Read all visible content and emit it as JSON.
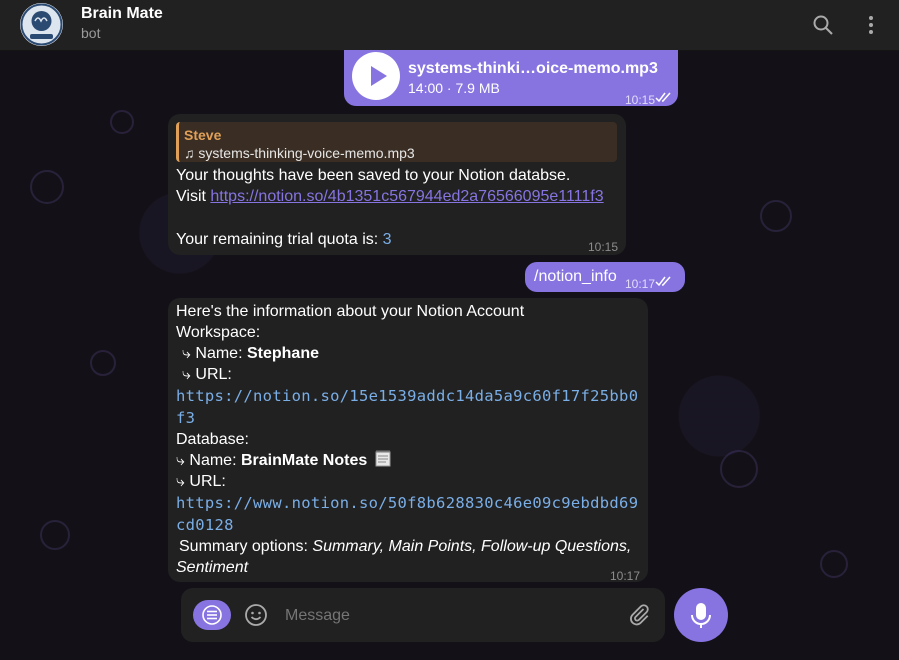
{
  "header": {
    "title": "Brain Mate",
    "subtitle": "bot",
    "avatar_label": "BrainMate"
  },
  "messages": {
    "audio": {
      "filename": "systems-thinki…oice-memo.mp3",
      "meta": "14:00 · 7.9 MB",
      "time": "10:15"
    },
    "saved": {
      "reply_author": "Steve",
      "reply_file": "systems-thinking-voice-memo.mp3",
      "reply_icon": "♫",
      "line1": "Your thoughts have been saved to your Notion databse.",
      "visit_label": "Visit",
      "link": "https://notion.so/4b1351c567944ed2a76566095e1111f3",
      "quota_label": "Your remaining trial quota is:",
      "quota_value": "3",
      "time": "10:15"
    },
    "command": {
      "text": "/notion_info",
      "time": "10:17"
    },
    "info": {
      "intro": "Here's the information about your Notion Account",
      "workspace_label": "Workspace:",
      "ws_name_label": "⤷ Name:",
      "ws_name": "Stephane",
      "ws_url_label": "⤷ URL:",
      "ws_url_1": "https://notion.so/15e1539addc14da5a9c60f17f25bb0",
      "ws_url_2": "f3",
      "database_label": "Database:",
      "db_name_label": "⤷ Name:",
      "db_name": "BrainMate Notes",
      "db_url_label": "⤷ URL:",
      "db_url_1": "https://www.notion.so/50f8b628830c46e09c9ebdbd69",
      "db_url_2": "cd0128",
      "summary_label": "Summary options:",
      "summary_values": "Summary, Main Points, Follow-up Questions,",
      "summary_values_2": "Sentiment",
      "time": "10:17"
    }
  },
  "composer": {
    "placeholder": "Message"
  },
  "colors": {
    "accent": "#8774e1",
    "header_bg": "#212121",
    "bubble_in": "#212121",
    "link_mono": "#7aaee6",
    "reply_author": "#e0a058"
  },
  "icons": [
    "search-icon",
    "more-vert-icon",
    "play-icon",
    "read-check-icon",
    "menu-icon",
    "emoji-icon",
    "attach-icon",
    "mic-icon",
    "notepad-icon"
  ]
}
